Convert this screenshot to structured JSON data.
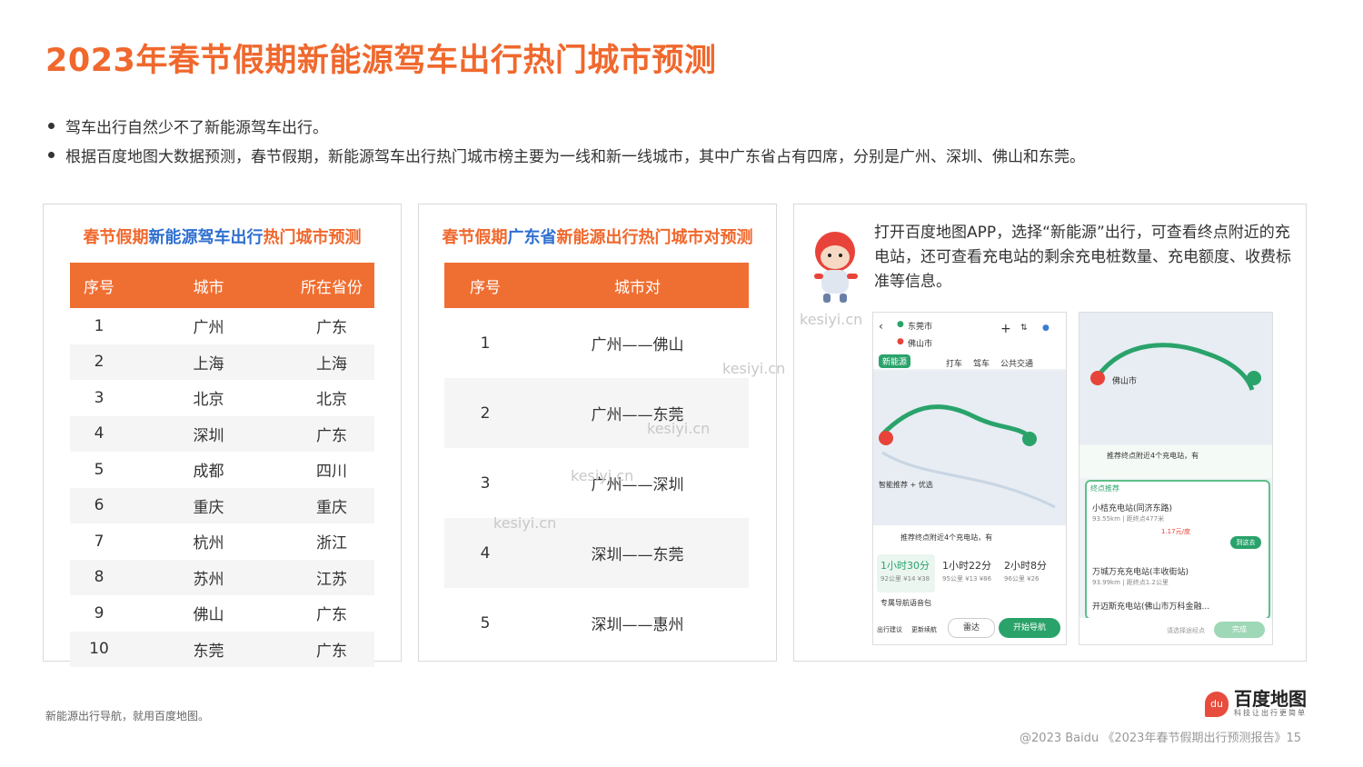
{
  "page_title": "2023年春节假期新能源驾车出行热门城市预测",
  "bullets": [
    "驾车出行自然少不了新能源驾车出行。",
    "根据百度地图大数据预测，春节假期，新能源驾车出行热门城市榜主要为一线和新一线城市，其中广东省占有四席，分别是广州、深圳、佛山和东莞。"
  ],
  "panel1": {
    "title_parts": [
      "春节假期",
      "新能源驾车出行",
      "热门城市预测"
    ],
    "headers": [
      "序号",
      "城市",
      "所在省份"
    ],
    "rows": [
      [
        "1",
        "广州",
        "广东"
      ],
      [
        "2",
        "上海",
        "上海"
      ],
      [
        "3",
        "北京",
        "北京"
      ],
      [
        "4",
        "深圳",
        "广东"
      ],
      [
        "5",
        "成都",
        "四川"
      ],
      [
        "6",
        "重庆",
        "重庆"
      ],
      [
        "7",
        "杭州",
        "浙江"
      ],
      [
        "8",
        "苏州",
        "江苏"
      ],
      [
        "9",
        "佛山",
        "广东"
      ],
      [
        "10",
        "东莞",
        "广东"
      ]
    ]
  },
  "panel2": {
    "title_parts": [
      "春节假期",
      "广东省",
      "新能源出行热门城市对预测"
    ],
    "headers": [
      "序号",
      "城市对"
    ],
    "rows": [
      [
        "1",
        "广州——佛山"
      ],
      [
        "2",
        "广州——东莞"
      ],
      [
        "3",
        "广州——深圳"
      ],
      [
        "4",
        "深圳——东莞"
      ],
      [
        "5",
        "深圳——惠州"
      ]
    ]
  },
  "panel3": {
    "description": "打开百度地图APP，选择“新能源”出行，可查看终点附近的充电站，还可查看充电站的剩余充电桩数量、充电额度、收费标准等信息。",
    "phone1": {
      "from": "东莞市",
      "to": "佛山市",
      "mode_new_energy": "新能源",
      "modes": [
        "打车",
        "驾车",
        "公共交通"
      ],
      "smart_recommend": "智能推荐 + 优选",
      "recommend_text": "推荐终点附近4个充电站，有",
      "route_options": [
        {
          "time": "1小时30分",
          "detail": "92公里 ¥14 ¥38"
        },
        {
          "time": "1小时22分",
          "detail": "95公里 ¥13 ¥86"
        },
        {
          "time": "2小时8分",
          "detail": "96公里 ¥26"
        }
      ],
      "voice_pack": "专属导航语音包",
      "bottom_actions": [
        "出行建议",
        "更新续航"
      ],
      "radar_label": "雷达",
      "start_nav_label": "开始导航"
    },
    "phone2": {
      "city_label": "佛山市",
      "recommend_text": "推荐终点附近4个充电站，有",
      "section_title": "终点推荐",
      "stations": [
        {
          "name": "小桔充电站(同济东路)",
          "detail": "93.55km | 距终点477米",
          "price": "1.17元/度"
        },
        {
          "name": "万城万充充电站(丰收街站)",
          "detail": "93.99km | 距终点1.2公里",
          "price": ""
        },
        {
          "name": "开迈斯充电站(佛山市万科金融...",
          "detail": "",
          "price": ""
        }
      ],
      "route_button": "到这去",
      "waypoint_placeholder": "请选择途经点",
      "done_label": "完成"
    }
  },
  "watermarks": [
    "kesiyi.cn",
    "kesiyi.cn",
    "kesiyi.cn",
    "kesiyi.cn",
    "kesiyi.cn"
  ],
  "footer": {
    "left": "新能源出行导航，就用百度地图。",
    "right": "@2023 Baidu 《2023年春节假期出行预测报告》15",
    "logo_name": "百度地图",
    "logo_slogan": "科技让出行更简单",
    "logo_icon_text": "du"
  }
}
